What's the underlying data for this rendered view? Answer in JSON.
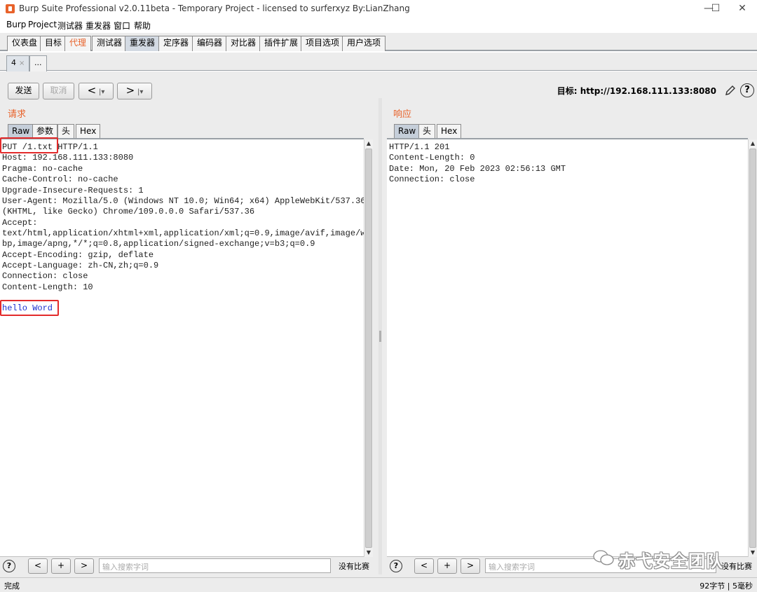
{
  "window": {
    "title": "Burp Suite Professional v2.0.11beta - Temporary Project - licensed to surferxyz By:LianZhang",
    "controls": {
      "minimize": "—",
      "maximize": "☐",
      "close": "✕"
    }
  },
  "menu": [
    "Burp",
    "Project",
    "测试器",
    "重发器",
    "窗口",
    "帮助"
  ],
  "main_tabs": [
    {
      "label": "仪表盘"
    },
    {
      "label": "目标"
    },
    {
      "label": "代理"
    },
    {
      "label": "测试器"
    },
    {
      "label": "重发器"
    },
    {
      "label": "定序器"
    },
    {
      "label": "编码器"
    },
    {
      "label": "对比器"
    },
    {
      "label": "插件扩展"
    },
    {
      "label": "项目选项"
    },
    {
      "label": "用户选项"
    }
  ],
  "active_main_tab": "重发器",
  "sub_tabs": [
    {
      "label": "4",
      "close": "×"
    },
    {
      "label": "..."
    }
  ],
  "toolbar": {
    "send": "发送",
    "cancel": "取消",
    "back": "<",
    "back_menu": "|▾",
    "forward": ">",
    "forward_menu": "|▾",
    "target_prefix": "目标:",
    "target_url": "http://192.168.111.133:8080",
    "help": "?"
  },
  "request": {
    "title": "请求",
    "tabs": [
      "Raw",
      "参数",
      "头",
      "Hex"
    ],
    "active_tab": "Raw",
    "lines": [
      "PUT /1.txt HTTP/1.1",
      "Host: 192.168.111.133:8080",
      "Pragma: no-cache",
      "Cache-Control: no-cache",
      "Upgrade-Insecure-Requests: 1",
      "User-Agent: Mozilla/5.0 (Windows NT 10.0; Win64; x64) AppleWebKit/537.36",
      "(KHTML, like Gecko) Chrome/109.0.0.0 Safari/537.36",
      "Accept:",
      "text/html,application/xhtml+xml,application/xml;q=0.9,image/avif,image/we",
      "bp,image/apng,*/*;q=0.8,application/signed-exchange;v=b3;q=0.9",
      "Accept-Encoding: gzip, deflate",
      "Accept-Language: zh-CN,zh;q=0.9",
      "Connection: close",
      "Content-Length: 10"
    ],
    "body": "hello Word",
    "search_placeholder": "输入搜索字词",
    "match_text": "没有比赛"
  },
  "response": {
    "title": "响应",
    "tabs": [
      "Raw",
      "头",
      "Hex"
    ],
    "active_tab": "Raw",
    "lines": [
      "HTTP/1.1 201",
      "Content-Length: 0",
      "Date: Mon, 20 Feb 2023 02:56:13 GMT",
      "Connection: close"
    ],
    "search_placeholder": "输入搜索字词",
    "match_text": "没有比赛"
  },
  "search_controls": {
    "prev": "<",
    "add": "+",
    "next": ">",
    "help": "?"
  },
  "status": {
    "left": "完成",
    "right": "92字节 | 5毫秒"
  },
  "watermark": "赤弋安全团队",
  "colors": {
    "accent": "#e8622a",
    "highlight": "#e32b2b",
    "body_text": "#1a2fcf"
  }
}
